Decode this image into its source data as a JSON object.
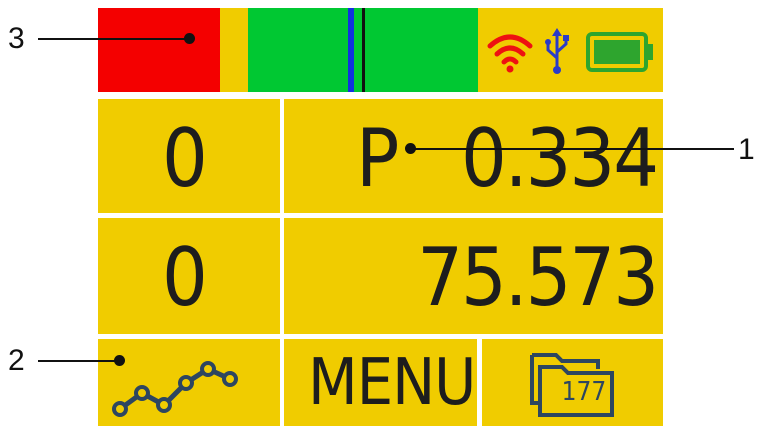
{
  "callouts": {
    "one": "1",
    "two": "2",
    "three": "3"
  },
  "status_bar": {
    "icons": [
      "wifi-icon",
      "usb-icon",
      "battery-icon"
    ],
    "colors": {
      "alarm": "#f40000",
      "ok_zone": "#00c832",
      "marker_blue": "#1030e0",
      "marker_black": "#111111",
      "wifi": "#ee1111",
      "usb": "#2a3bc8",
      "battery": "#2ea52e"
    }
  },
  "display": {
    "row1": {
      "left_value": "0",
      "prefix": "P",
      "value": "0.334"
    },
    "row2": {
      "left_value": "0",
      "value": "75.573"
    }
  },
  "bottom_bar": {
    "chart_icon": "line-chart-icon",
    "menu_label": "MENU",
    "folder_icon": "folder-icon",
    "folder_count": "177"
  },
  "colors": {
    "panel": "#f0cc00",
    "divider": "#ffffff",
    "text": "#1d1d1d"
  }
}
